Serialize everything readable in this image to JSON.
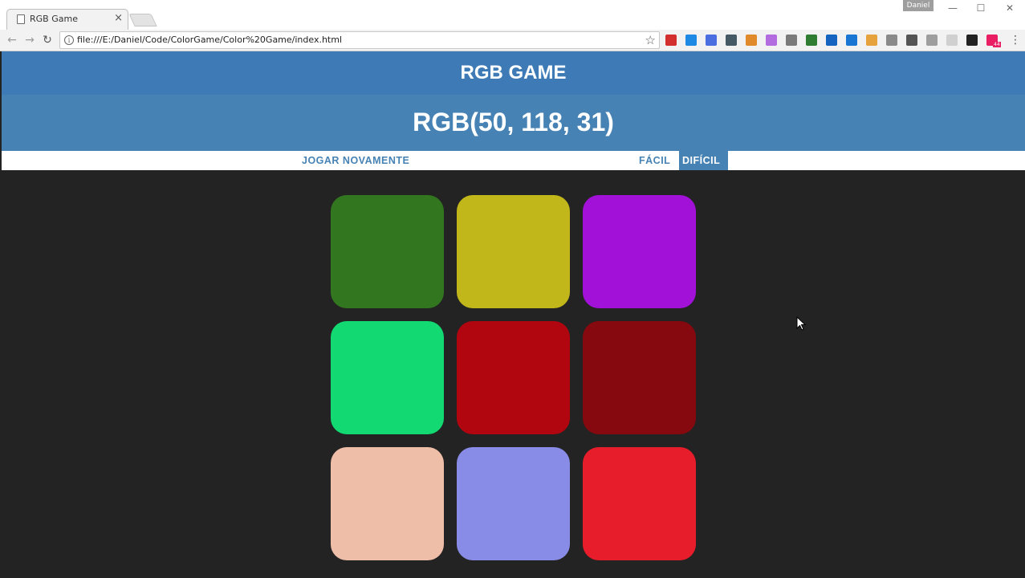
{
  "browser": {
    "tab_title": "RGB Game",
    "tab_close": "×",
    "profile_name": "Daniel",
    "window_controls": {
      "minimize": "—",
      "maximize": "☐",
      "close": "✕"
    },
    "nav": {
      "back": "←",
      "forward": "→",
      "reload": "↻"
    },
    "url": "file:///E:/Daniel/Code/ColorGame/Color%20Game/index.html",
    "star": "☆",
    "menu": "⋮",
    "extensions": [
      {
        "name": "lock-extension-icon",
        "color": "#d32f2f"
      },
      {
        "name": "calendar-extension-icon",
        "color": "#1e88e5"
      },
      {
        "name": "translate-extension-icon",
        "color": "#4a6ee0"
      },
      {
        "name": "eyedropper-extension-icon",
        "color": "#455a64"
      },
      {
        "name": "tag-extension-icon",
        "color": "#e08a2c"
      },
      {
        "name": "paint-extension-icon",
        "color": "#b36be0"
      },
      {
        "name": "cube-extension-icon",
        "color": "#7a7a7a"
      },
      {
        "name": "bw-extension-icon",
        "color": "#2e7d32"
      },
      {
        "name": "info-extension-icon",
        "color": "#1565c0"
      },
      {
        "name": "form-extension-icon",
        "color": "#1976d2"
      },
      {
        "name": "cookie-extension-icon",
        "color": "#e6a23c"
      },
      {
        "name": "shield-extension-icon",
        "color": "#8a8a8a"
      },
      {
        "name": "mail-extension-icon",
        "color": "#555555"
      },
      {
        "name": "grid-extension-icon",
        "color": "#9e9e9e"
      },
      {
        "name": "circle-extension-icon",
        "color": "#d0d0d0"
      },
      {
        "name": "chat-extension-icon",
        "color": "#222222"
      },
      {
        "name": "notification-extension-icon",
        "color": "#e91e63"
      }
    ],
    "notification_badge": "44"
  },
  "game": {
    "title": "RGB GAME",
    "rgb_display": "RGB(50, 118, 31)",
    "reset_label": "JOGAR NOVAMENTE",
    "easy_label": "FÁCIL",
    "hard_label": "DIFÍCIL",
    "selected_mode": "hard",
    "colors": {
      "header": "#3e7bb6",
      "header_lower": "#4682b4",
      "background": "#232323"
    },
    "squares": [
      "#32761f",
      "#c2b71a",
      "#a111d8",
      "#12d972",
      "#b1050f",
      "#85090e",
      "#efbea8",
      "#888ce7",
      "#e81d2b"
    ]
  }
}
